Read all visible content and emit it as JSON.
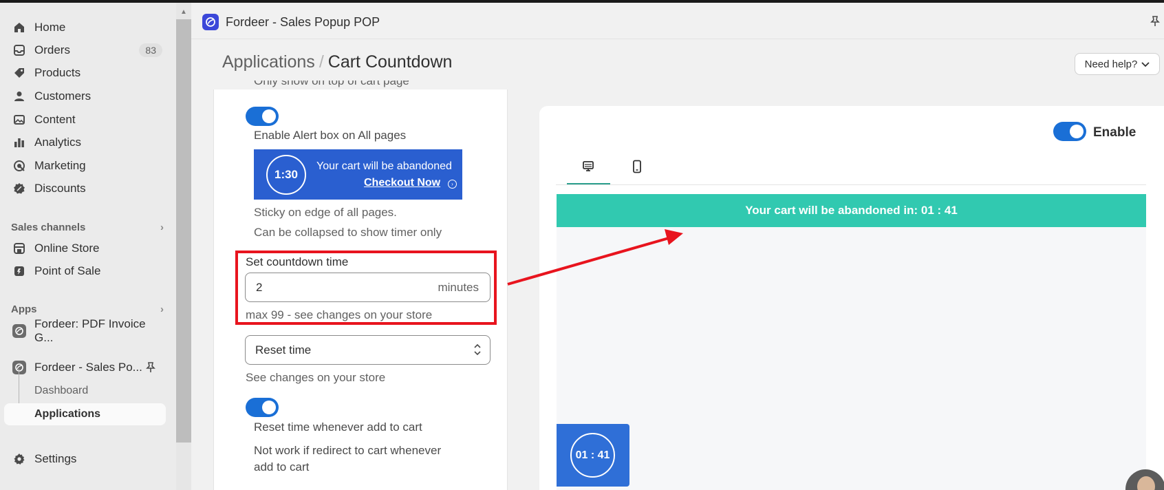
{
  "sidebar": {
    "items": [
      {
        "label": "Home",
        "icon": "home-icon"
      },
      {
        "label": "Orders",
        "icon": "inbox-icon",
        "badge": "83"
      },
      {
        "label": "Products",
        "icon": "tag-icon"
      },
      {
        "label": "Customers",
        "icon": "person-icon"
      },
      {
        "label": "Content",
        "icon": "image-icon"
      },
      {
        "label": "Analytics",
        "icon": "bar-chart-icon"
      },
      {
        "label": "Marketing",
        "icon": "target-icon"
      },
      {
        "label": "Discounts",
        "icon": "discount-icon"
      }
    ],
    "sales_channels": {
      "title": "Sales channels",
      "items": [
        {
          "label": "Online Store",
          "icon": "store-icon"
        },
        {
          "label": "Point of Sale",
          "icon": "pos-icon"
        }
      ]
    },
    "apps": {
      "title": "Apps",
      "items": [
        {
          "label": "Fordeer: PDF Invoice G..."
        },
        {
          "label": "Fordeer - Sales Po..."
        }
      ],
      "sub_items": [
        {
          "label": "Dashboard"
        },
        {
          "label": "Applications"
        }
      ]
    },
    "settings": {
      "label": "Settings",
      "icon": "gear-icon"
    }
  },
  "app_bar": {
    "title": "Fordeer - Sales Popup POP"
  },
  "breadcrumb": {
    "parent": "Applications",
    "separator": "/",
    "current": "Cart Countdown"
  },
  "help_button": {
    "label": "Need help?"
  },
  "settings": {
    "cut_off_text": "Only show on top of cart page",
    "alert_toggle_label": "Enable Alert box on All pages",
    "alert_box": {
      "timer": "1:30",
      "text": "Your cart will be abandoned",
      "link": "Checkout Now"
    },
    "sticky_text": "Sticky on edge of all pages.",
    "collapse_text": "Can be collapsed to show timer only",
    "countdown": {
      "label": "Set countdown time",
      "value": "2",
      "suffix": "minutes",
      "help": "max 99 - see changes on your store"
    },
    "reset_select": {
      "value": "Reset time",
      "help": "See changes on your store"
    },
    "reset_toggle_label": "Reset time whenever add to cart",
    "note_line1": "Not work if redirect to cart whenever",
    "note_line2": "add to cart"
  },
  "preview": {
    "enable_label": "Enable",
    "tabs": [
      {
        "icon": "desktop-icon"
      },
      {
        "icon": "mobile-icon"
      }
    ],
    "banner_text": "Your cart will be abandoned in: 01 : 41",
    "timer_text": "01 : 41"
  },
  "colors": {
    "accent_blue": "#1a6fd6",
    "banner_teal": "#31c9b0",
    "annotation_red": "#e8141e",
    "alert_blue": "#2a5fd0"
  }
}
